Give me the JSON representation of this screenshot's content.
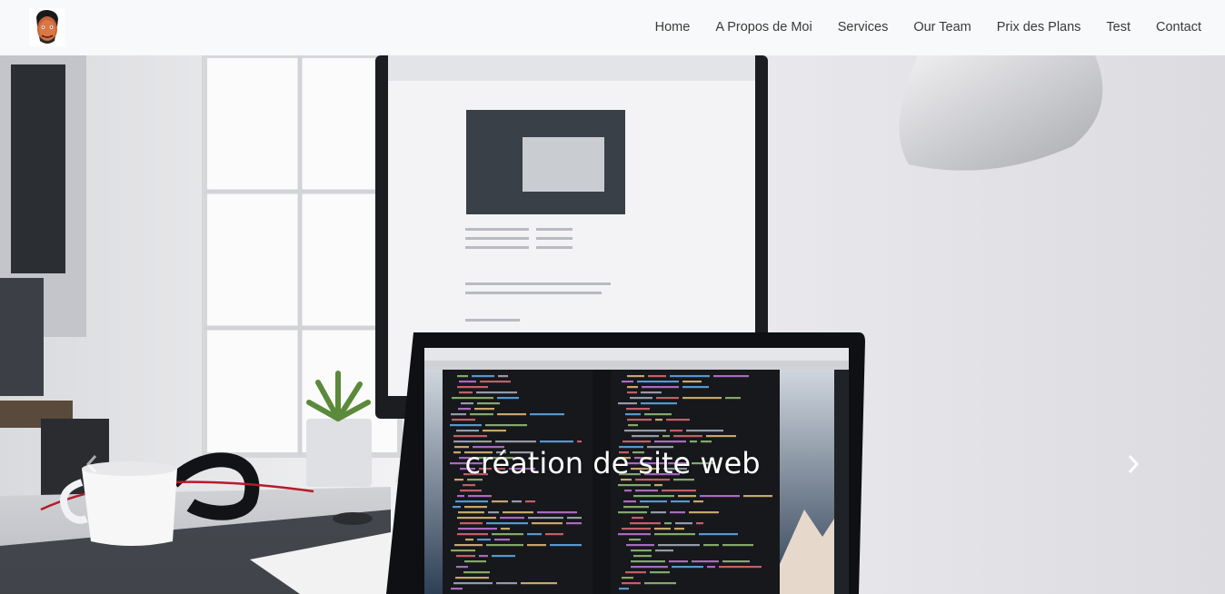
{
  "navbar": {
    "brand_icon": "avatar-cartoon-face-icon",
    "links": [
      {
        "label": "Home"
      },
      {
        "label": "A Propos de Moi"
      },
      {
        "label": "Services"
      },
      {
        "label": "Our Team"
      },
      {
        "label": "Prix des Plans"
      },
      {
        "label": "Test"
      },
      {
        "label": "Contact"
      }
    ]
  },
  "carousel": {
    "slide_caption": "création de site web",
    "prev_icon": "chevron-left-icon",
    "next_icon": "chevron-right-icon",
    "image": "desk-workspace-photo"
  },
  "colors": {
    "navbar_bg": "#f8f9fa",
    "nav_text": "#3a3a3a",
    "caption_text": "#ffffff"
  }
}
